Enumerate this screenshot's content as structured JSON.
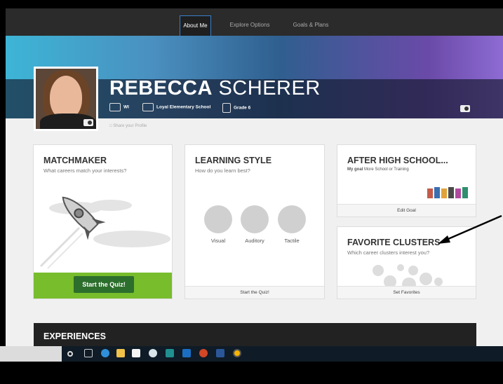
{
  "nav": {
    "tabs": [
      {
        "label": "About Me",
        "active": true
      },
      {
        "label": "Explore Options",
        "active": false
      },
      {
        "label": "Goals & Plans",
        "active": false
      }
    ]
  },
  "profile": {
    "first_name": "REBECCA",
    "last_name": "SCHERER",
    "state": "WI",
    "school": "Loyal Elementary School",
    "grade": "Grade 6",
    "share_label": "Share your Profile"
  },
  "cards": {
    "matchmaker": {
      "title": "MATCHMAKER",
      "subtitle": "What careers match your interests?",
      "button": "Start the Quiz!"
    },
    "learning_style": {
      "title": "LEARNING STYLE",
      "subtitle": "How do you learn best?",
      "options": [
        "Visual",
        "Auditory",
        "Tactile"
      ],
      "footer": "Start the Quiz!"
    },
    "after_high_school": {
      "title": "AFTER HIGH SCHOOL...",
      "goal_label": "My goal",
      "goal_value": "More School or Training",
      "footer": "Edit Goal"
    },
    "favorite_clusters": {
      "title": "FAVORITE CLUSTERS",
      "subtitle": "Which career clusters interest you?",
      "footer": "Set Favorites"
    }
  },
  "experiences": {
    "title": "EXPERIENCES"
  },
  "colors": {
    "accent_green": "#78bd2c",
    "dark_green": "#2c6e2c",
    "nav_bg": "#2b2b2b"
  },
  "taskbar_icons": [
    "search-icon",
    "task-view-icon",
    "edge-icon",
    "file-explorer-icon",
    "store-icon",
    "paint-icon",
    "publisher-icon",
    "outlook-icon",
    "powerpoint-icon",
    "word-icon",
    "chrome-icon"
  ]
}
